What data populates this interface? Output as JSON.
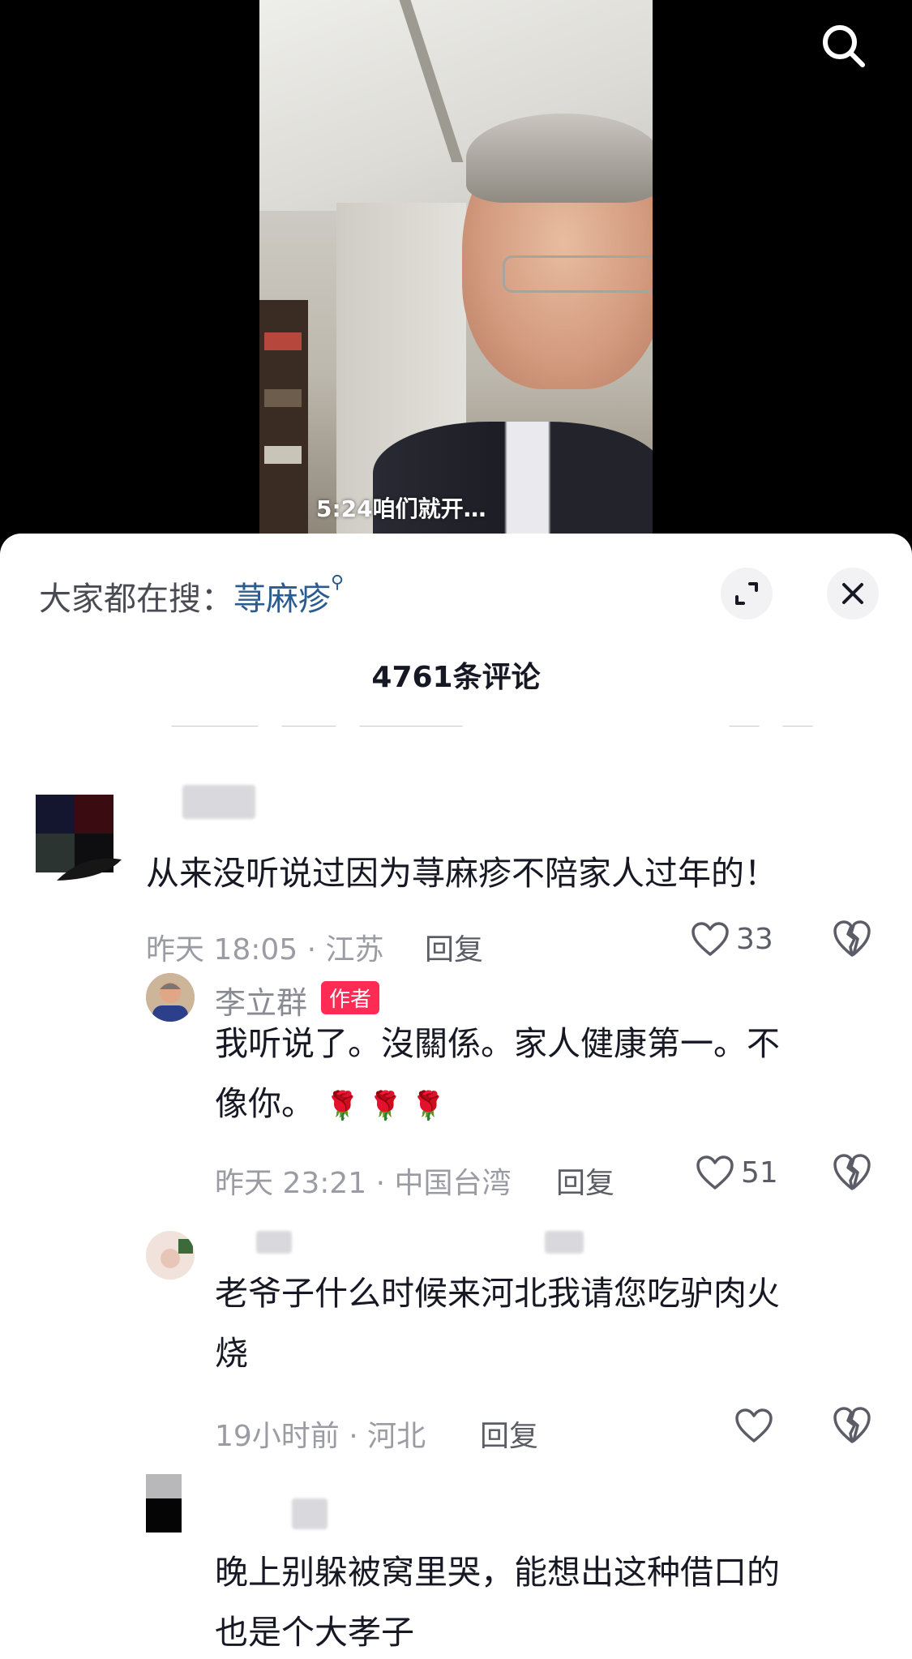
{
  "video": {
    "subtitle": "5:24咱们就开…"
  },
  "sheet": {
    "trending_label": "大家都在搜：",
    "trending_keyword": "荨麻疹",
    "search_glyph": "⚲",
    "comment_count": "4761条评论"
  },
  "comments": [
    {
      "text": "从来没听说过因为荨麻疹不陪家人过年的！",
      "meta": "昨天 18:05 · 江苏",
      "reply_label": "回复",
      "likes": "33"
    },
    {
      "author": "李立群",
      "badge": "作者",
      "text_line1": "我听说了。沒關係。家人健康第一。不",
      "text_line2": "像你。",
      "emoji": "🌹 🌹 🌹",
      "meta": "昨天 23:21 · 中国台湾",
      "reply_label": "回复",
      "likes": "51"
    },
    {
      "text_line1": "老爷子什么时候来河北我请您吃驴肉火",
      "text_line2": "烧",
      "meta": "19小时前 · 河北",
      "reply_label": "回复"
    },
    {
      "text_line1": "晚上别躲被窝里哭，能想出这种借口的",
      "text_line2": "也是个大孝子"
    }
  ],
  "colors": {
    "link": "#2b5c8f",
    "badge": "#fe2c55",
    "meta": "#9b9ba3"
  },
  "icons": [
    "search-icon",
    "expand-icon",
    "close-icon",
    "heart-icon",
    "broken-heart-icon",
    "rose-icon"
  ]
}
